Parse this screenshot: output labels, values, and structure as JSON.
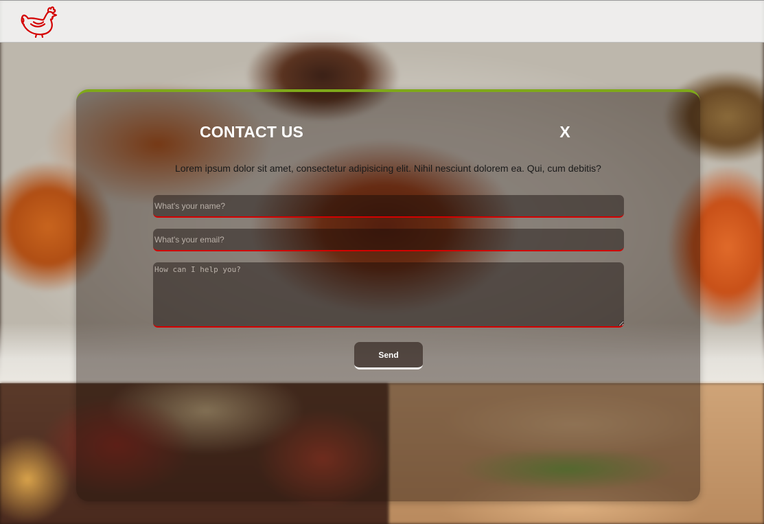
{
  "nav": {
    "logo_icon": "chicken-logo-icon",
    "logo_color": "#d40000"
  },
  "modal": {
    "title": "CONTACT US",
    "close_label": "X",
    "description": "Lorem ipsum dolor sit amet, consectetur adipisicing elit. Nihil nesciunt dolorem ea. Qui, cum debitis?",
    "name_placeholder": "What's your name?",
    "email_placeholder": "What's your email?",
    "message_placeholder": "How can I help you?",
    "send_label": "Send",
    "accent_top": "#7fa81a",
    "accent_fields": "#d40000"
  }
}
